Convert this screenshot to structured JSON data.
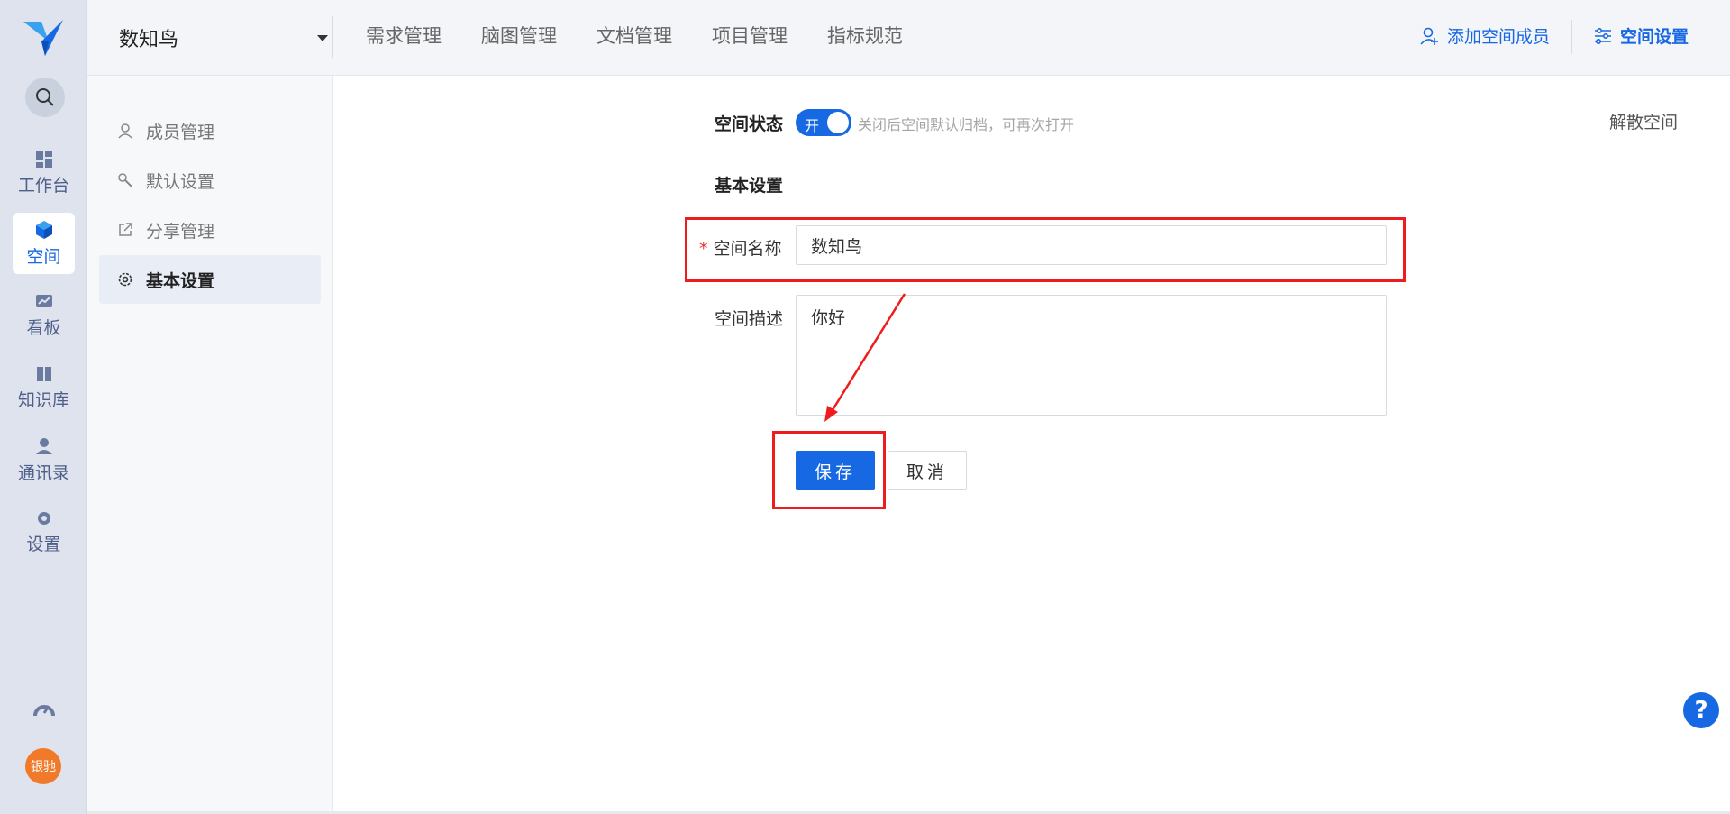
{
  "rail": {
    "items": [
      {
        "label": "工作台",
        "icon": "dashboard-icon"
      },
      {
        "label": "空间",
        "icon": "cube-icon",
        "active": true
      },
      {
        "label": "看板",
        "icon": "chart-icon"
      },
      {
        "label": "知识库",
        "icon": "book-icon"
      },
      {
        "label": "通讯录",
        "icon": "contacts-icon"
      },
      {
        "label": "设置",
        "icon": "gear-icon"
      }
    ],
    "avatar_text": "银驰"
  },
  "topbar": {
    "space_name": "数知鸟",
    "nav": [
      "需求管理",
      "脑图管理",
      "文档管理",
      "项目管理",
      "指标规范"
    ],
    "add_member": "添加空间成员",
    "space_settings": "空间设置"
  },
  "subnav": {
    "items": [
      {
        "label": "成员管理",
        "icon": "user-icon"
      },
      {
        "label": "默认设置",
        "icon": "wrench-icon"
      },
      {
        "label": "分享管理",
        "icon": "share-icon"
      },
      {
        "label": "基本设置",
        "icon": "gear-icon",
        "active": true
      }
    ]
  },
  "form": {
    "status_label": "空间状态",
    "switch_text": "开",
    "status_hint": "关闭后空间默认归档，可再次打开",
    "dissolve": "解散空间",
    "section_title": "基本设置",
    "name_required": "*",
    "name_label": "空间名称",
    "name_value": "数知鸟",
    "desc_label": "空间描述",
    "desc_value": "你好",
    "save": "保存",
    "cancel": "取消"
  },
  "help_text": "?",
  "colors": {
    "accent": "#1668e3",
    "annotation": "#ee1c1c"
  }
}
